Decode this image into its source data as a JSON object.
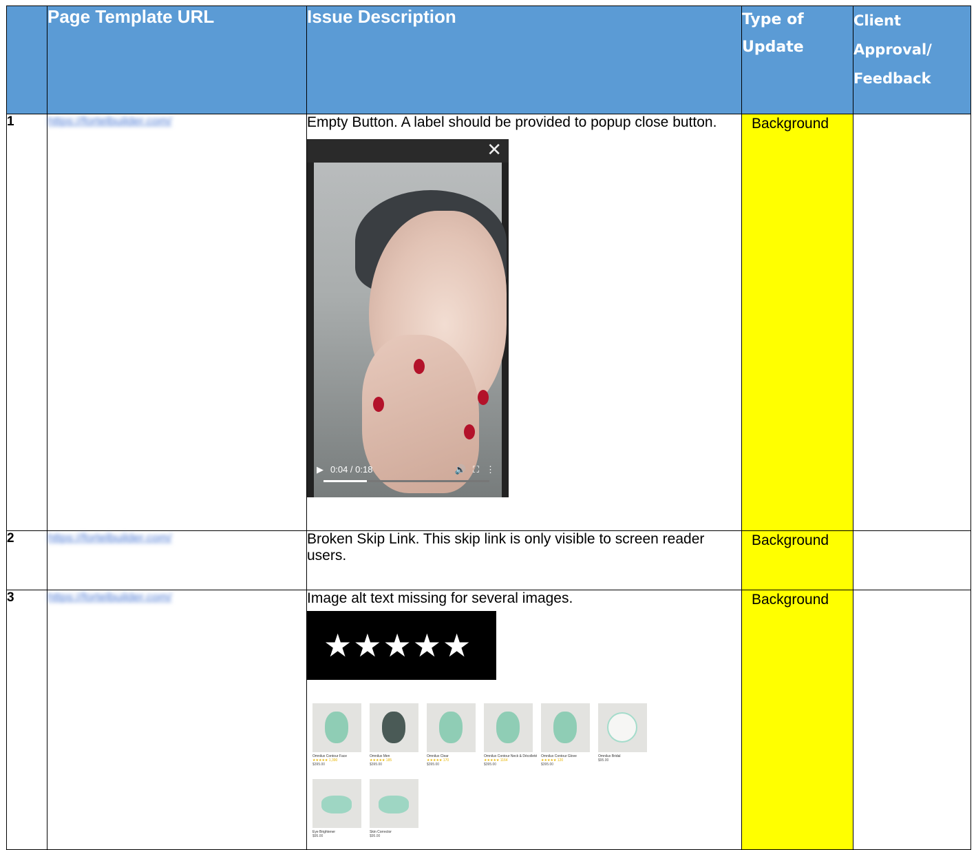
{
  "header": {
    "num": "",
    "url": "Page Template URL",
    "desc": "Issue Description",
    "type_line1": "Type of",
    "type_line2": "Update",
    "client_line1": "Client",
    "client_line2": "Approval/",
    "client_line3": "Feedback"
  },
  "rows": [
    {
      "num": "1",
      "url": "https://fortelbuilder.com/",
      "desc": "Empty Button. A label should be provided to popup close button.",
      "type": "Background",
      "video": {
        "close_icon": "close-icon",
        "time": "0:04 / 0:18",
        "progress": 0.26,
        "buffered": 0.43
      }
    },
    {
      "num": "2",
      "url": "https://fortelbuilder.com/",
      "desc": "Broken Skip Link. This skip link is only visible to screen reader users.",
      "type": "Background"
    },
    {
      "num": "3",
      "url": "https://fortelbuilder.com/",
      "desc": "Image alt text missing for several images.",
      "type": "Background",
      "stars": "★★★★★",
      "products": [
        {
          "name": "Omnilux Contour Face",
          "stars": "★★★★★ 1,390",
          "price": "$395.00"
        },
        {
          "name": "Omnilux Men",
          "stars": "★★★★★ 185",
          "price": "$395.00"
        },
        {
          "name": "Omnilux Clear",
          "stars": "★★★★★ 170",
          "price": "$395.00"
        },
        {
          "name": "Omnilux Contour Neck & Décolleté",
          "stars": "★★★★★ 1164",
          "price": "$395.00"
        },
        {
          "name": "Omnilux Contour Glove",
          "stars": "★★★★★ 120",
          "price": "$395.00"
        },
        {
          "name": "Omnilux Bridal",
          "stars": "",
          "price": "$95.00"
        },
        {
          "name": "Eye Brightener",
          "stars": "",
          "price": "$95.00"
        },
        {
          "name": "Skin Corrector",
          "stars": "",
          "price": "$95.00"
        }
      ]
    }
  ],
  "colors": {
    "header_bg": "#5b9bd5",
    "highlight": "#ffff00"
  }
}
